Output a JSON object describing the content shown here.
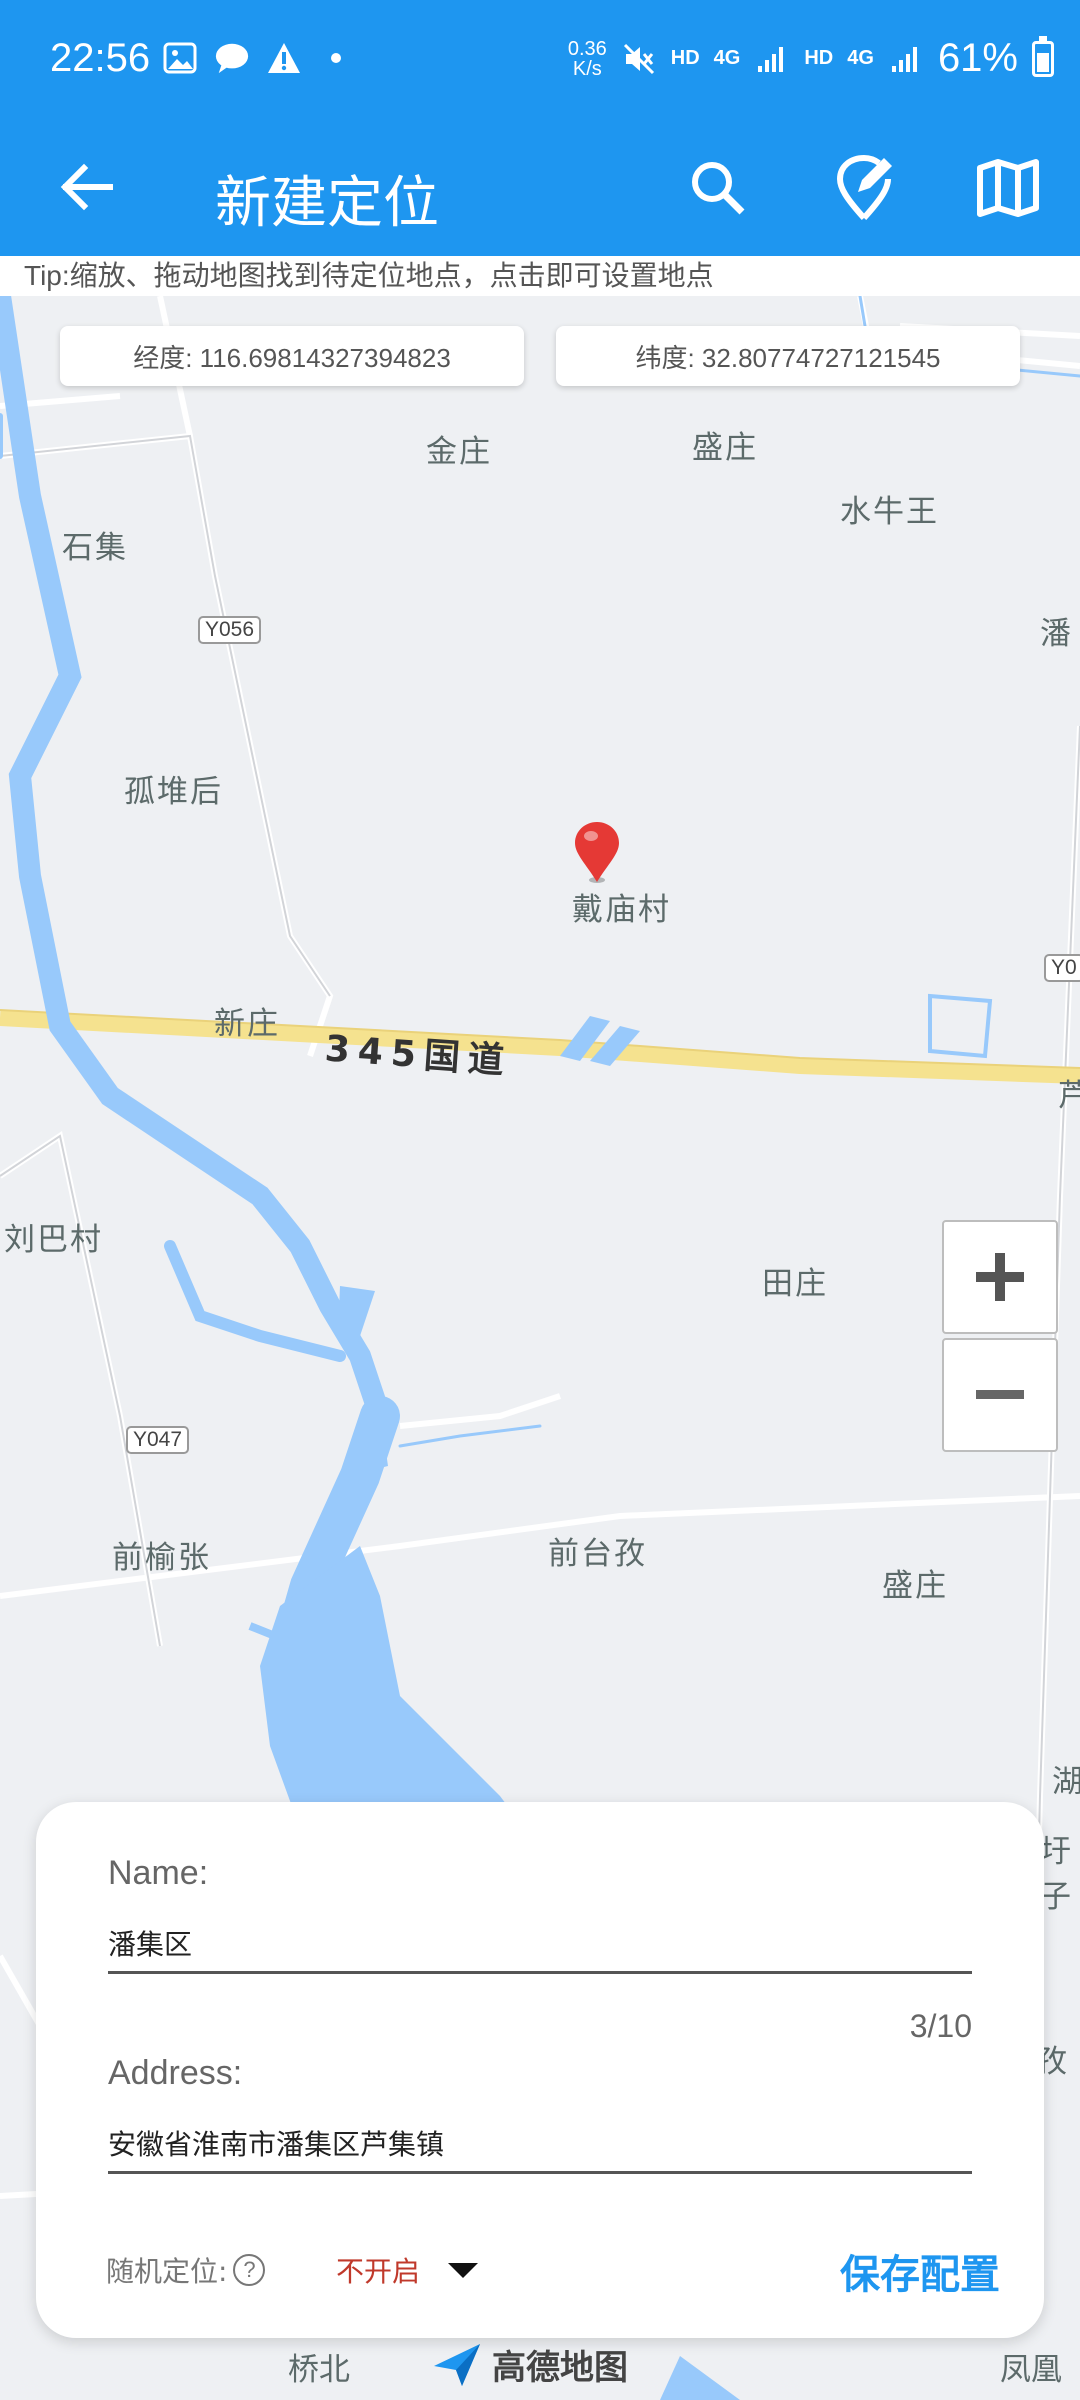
{
  "status_bar": {
    "time": "22:56",
    "speed_value": "0.36",
    "speed_unit": "K/s",
    "hd1": "HD",
    "net1": "4G",
    "hd2": "HD",
    "net2": "4G",
    "battery": "61%",
    "battery_level": 0.61
  },
  "app_bar": {
    "title": "新建定位"
  },
  "tip": "Tip:缩放、拖动地图找到待定位地点，点击即可设置地点",
  "coords": {
    "longitude": "经度: 116.69814327394823",
    "latitude": "纬度: 32.80774727121545"
  },
  "map": {
    "places": [
      "金庄",
      "盛庄",
      "水牛王",
      "石集",
      "潘",
      "孤堆后",
      "戴庙村",
      "新庄",
      "刘巴村",
      "田庄",
      "前榆张",
      "前台孜",
      "盛庄",
      "湖",
      "圩子",
      "芦",
      "孜"
    ],
    "road_tags": [
      "Y056",
      "Y047",
      "Y0"
    ],
    "highway": "345国道",
    "bottom_places": [
      "桥北",
      "凤凰"
    ],
    "logo": "高德地图"
  },
  "form": {
    "name_label": "Name:",
    "name_value": "潘集区",
    "counter": "3/10",
    "address_label": "Address:",
    "address_value": "安徽省淮南市潘集区芦集镇",
    "random_label": "随机定位:",
    "random_help": "?",
    "random_value": "不开启",
    "save_label": "保存配置"
  },
  "colors": {
    "primary": "#1e96f0",
    "select_text": "#c0392b"
  }
}
